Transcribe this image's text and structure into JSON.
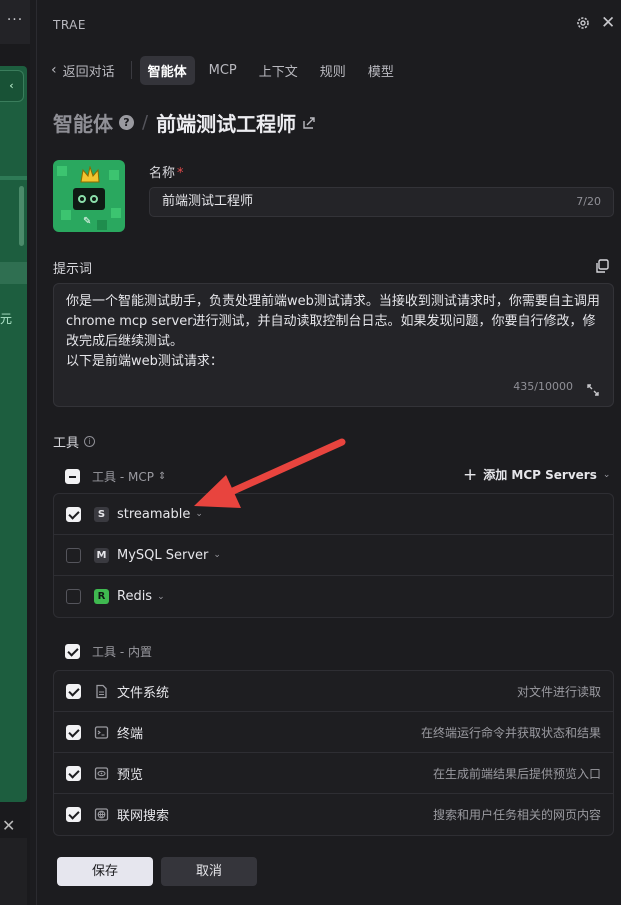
{
  "left_strip": {
    "top_glyph": "···",
    "collapse_chevron": "‹",
    "side_glyph": "元",
    "close_glyph": "✕"
  },
  "header": {
    "title": "TRAE"
  },
  "nav": {
    "back_label": "返回对话",
    "tabs": [
      {
        "label": "智能体",
        "active": true
      },
      {
        "label": "MCP",
        "active": false
      },
      {
        "label": "上下文",
        "active": false
      },
      {
        "label": "规则",
        "active": false
      },
      {
        "label": "模型",
        "active": false
      }
    ]
  },
  "breadcrumb": {
    "level1": "智能体",
    "level2": "前端测试工程师"
  },
  "name_field": {
    "label": "名称",
    "required_mark": "*",
    "value": "前端测试工程师",
    "count": "7/20"
  },
  "prompt": {
    "label": "提示词",
    "text": "你是一个智能测试助手，负责处理前端web测试请求。当接收到测试请求时，你需要自主调用chrome mcp server进行测试，并自动读取控制台日志。如果发现问题，你要自行修改，修改完成后继续测试。\n以下是前端web测试请求：",
    "count": "435/10000"
  },
  "tools": {
    "label": "工具",
    "mcp_group": {
      "label": "工具 - MCP",
      "add_button": "添加 MCP Servers"
    },
    "mcp_items": [
      {
        "name": "streamable",
        "badge": "S",
        "badge_bg": "#3a3a40",
        "badge_fg": "#e6e6ea",
        "checked": true
      },
      {
        "name": "MySQL Server",
        "badge": "M",
        "badge_bg": "#3a3a40",
        "badge_fg": "#e6e6ea",
        "checked": false
      },
      {
        "name": "Redis",
        "badge": "R",
        "badge_bg": "#3fb950",
        "badge_fg": "#0f1a14",
        "checked": false
      }
    ],
    "builtin_group": {
      "label": "工具 - 内置"
    },
    "builtin_items": [
      {
        "name": "文件系统",
        "desc": "对文件进行读取",
        "icon": "file-icon",
        "checked": true
      },
      {
        "name": "终端",
        "desc": "在终端运行命令并获取状态和结果",
        "icon": "terminal-icon",
        "checked": true
      },
      {
        "name": "预览",
        "desc": "在生成前端结果后提供预览入口",
        "icon": "eye-icon",
        "checked": true
      },
      {
        "name": "联网搜索",
        "desc": "搜索和用户任务相关的网页内容",
        "icon": "globe-icon",
        "checked": true
      }
    ]
  },
  "footer": {
    "save_label": "保存",
    "cancel_label": "取消"
  },
  "colors": {
    "accent_arrow": "#e8443e",
    "panel_bg": "#1c1c1f",
    "avatar_green": "#2aa85f",
    "editor_green": "#1d5e3f"
  }
}
